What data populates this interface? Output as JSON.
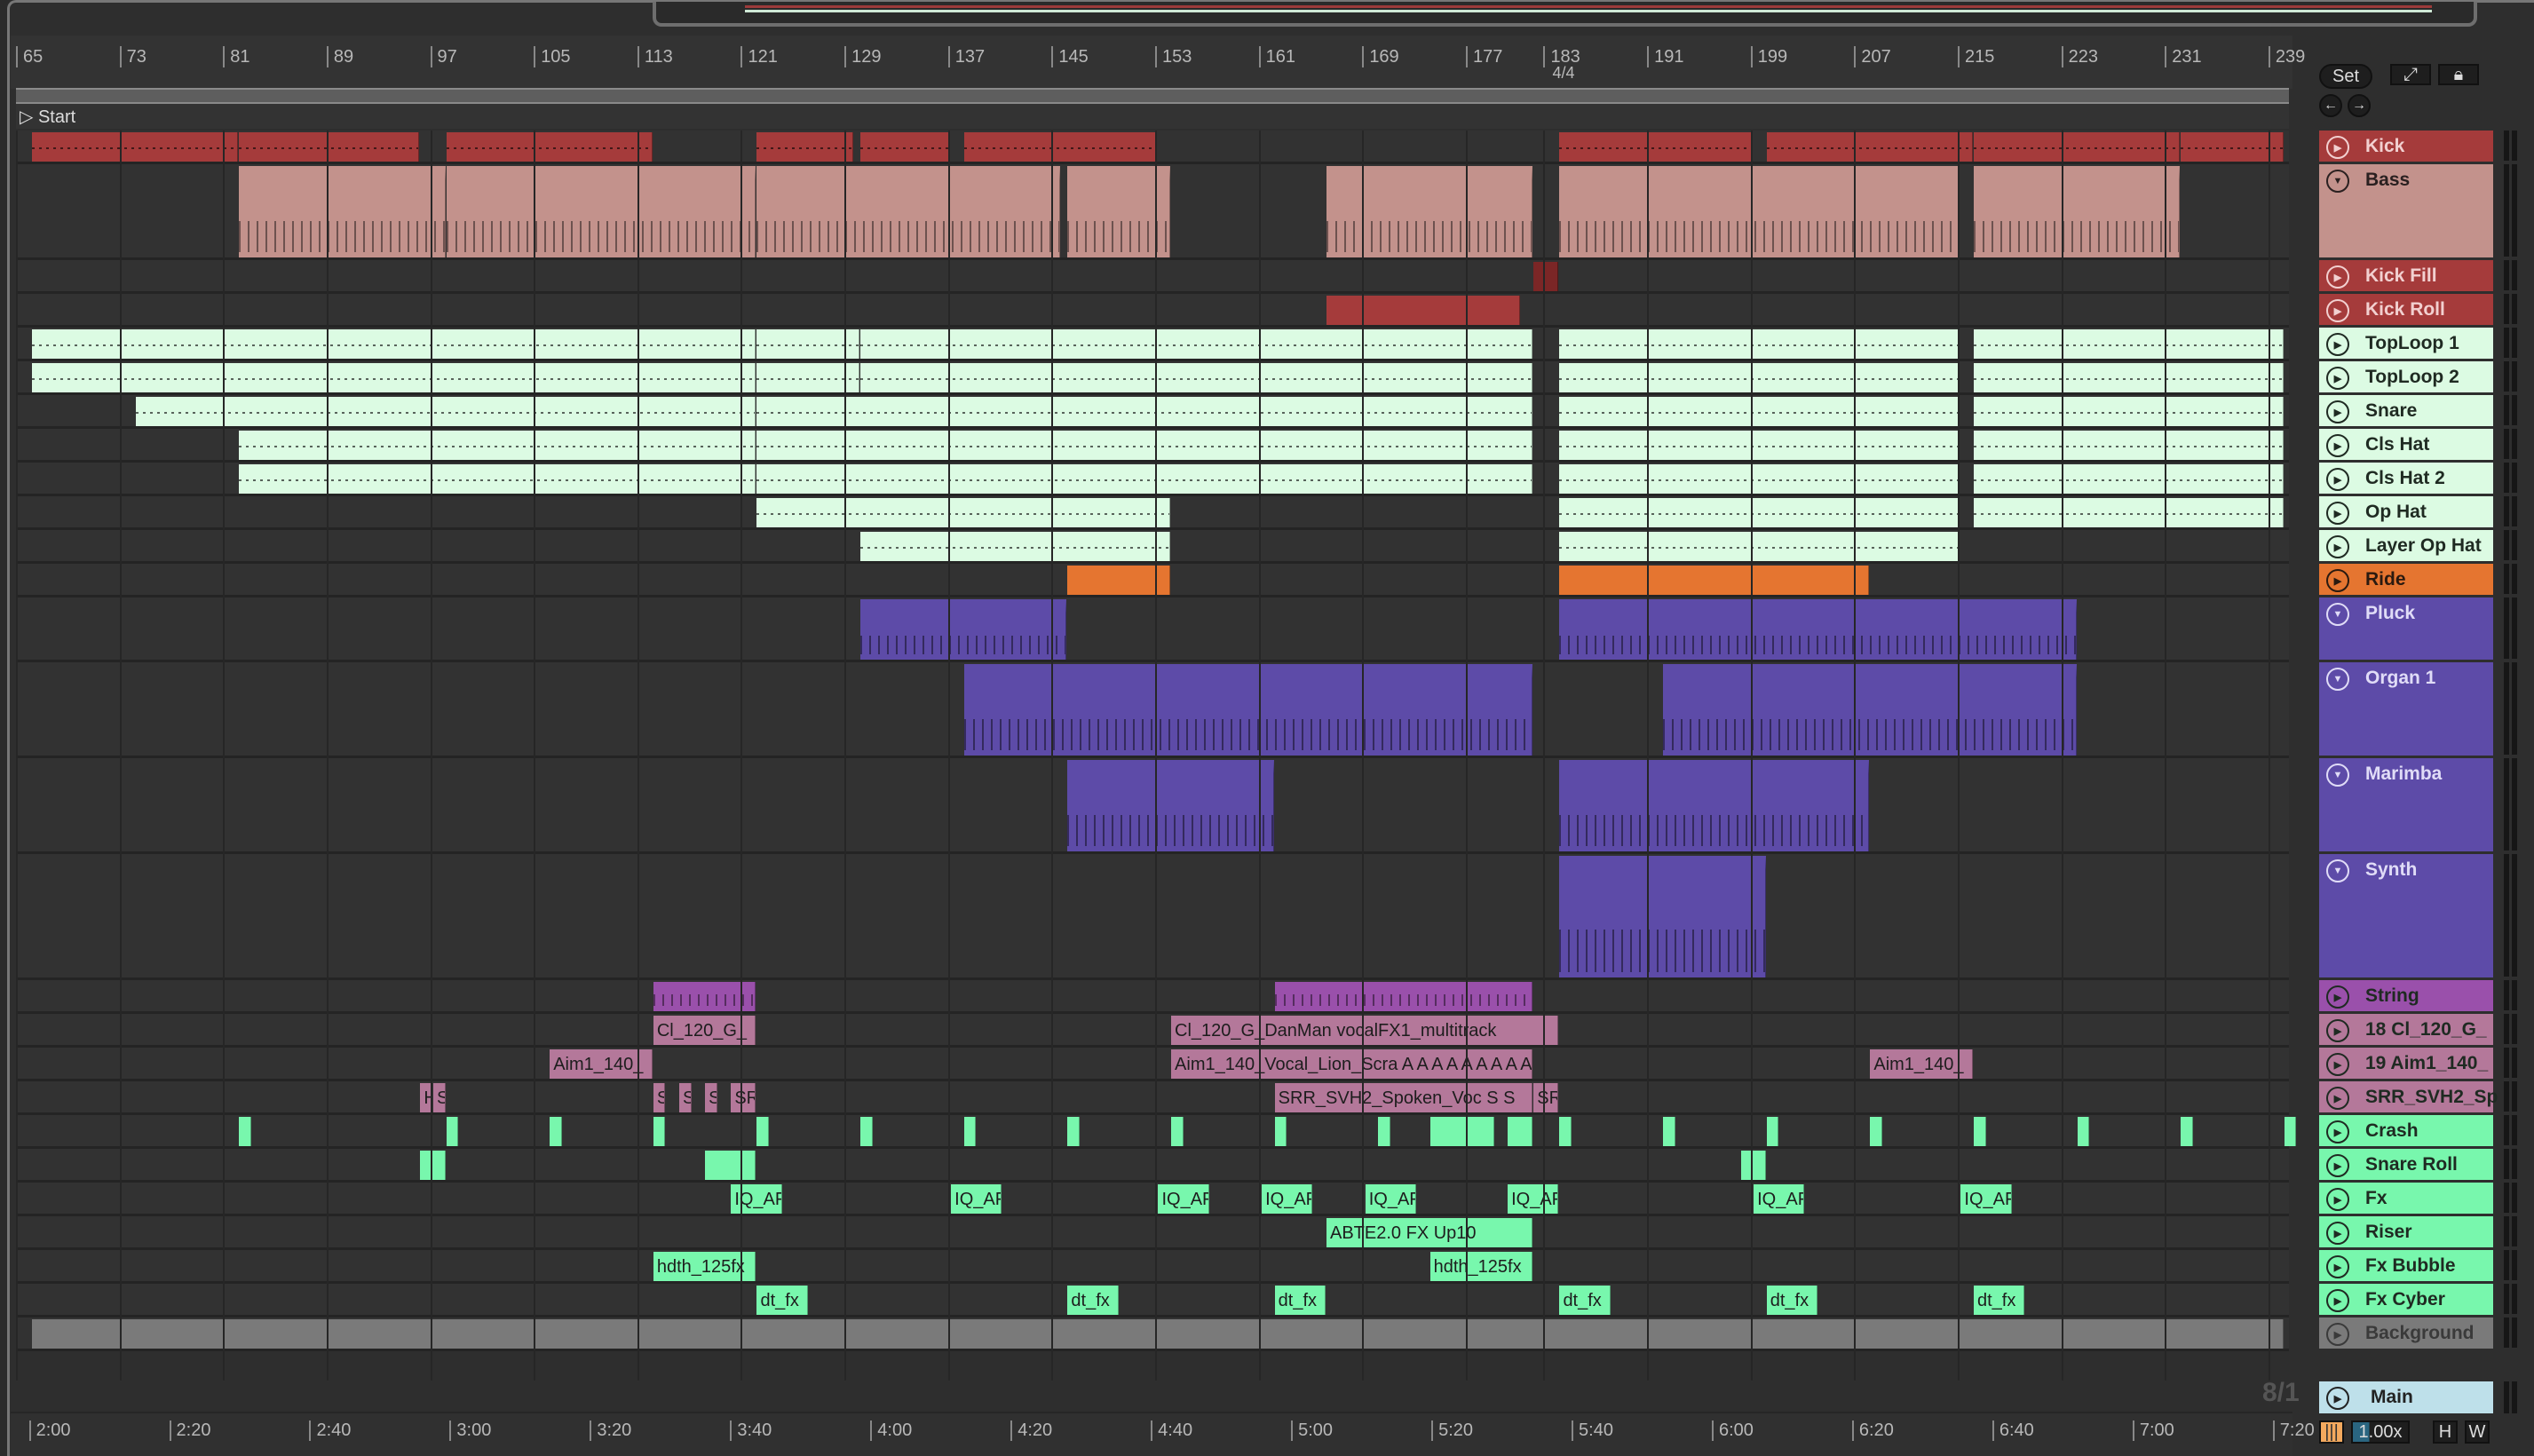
{
  "ruler": {
    "bars": [
      "65",
      "73",
      "81",
      "89",
      "97",
      "105",
      "113",
      "121",
      "129",
      "137",
      "145",
      "153",
      "161",
      "169",
      "177",
      "183",
      "191",
      "199",
      "207",
      "215",
      "223",
      "231",
      "239"
    ],
    "time_signature": "4/4",
    "locator": "Start"
  },
  "time_ruler": [
    "2:00",
    "2:20",
    "2:40",
    "3:00",
    "3:20",
    "3:40",
    "4:00",
    "4:20",
    "4:40",
    "5:00",
    "5:20",
    "5:40",
    "6:00",
    "6:20",
    "6:40",
    "7:00",
    "7:20"
  ],
  "controls": {
    "set": "Set",
    "prev": "←",
    "next": "→",
    "zoom": "1.00x",
    "h": "H",
    "w": "W",
    "grid": "8/1"
  },
  "colors": {
    "kick": "#a53b3b",
    "bass": "#c3928c",
    "fill": "#7b2626",
    "light": "#dcfbe3",
    "ride": "#e57530",
    "purple": "#5d4ba8",
    "string": "#9a50ab",
    "vocal": "#b4789a",
    "green": "#78f7ad",
    "bg": "#7a7a7a",
    "main": "#bee0ea"
  },
  "tracks": [
    {
      "name": "Kick",
      "h": "s",
      "color": "kick",
      "text": "#f2d0d0",
      "type": "line",
      "clips": [
        [
          65,
          81
        ],
        [
          81,
          95
        ],
        [
          97,
          113
        ],
        [
          121,
          128.5
        ],
        [
          129,
          136
        ],
        [
          137,
          152
        ],
        [
          183,
          198
        ],
        [
          199,
          215
        ],
        [
          215,
          231
        ],
        [
          231,
          239
        ]
      ]
    },
    {
      "name": "Bass",
      "h": "bass",
      "color": "bass",
      "text": "#2a2020",
      "fold": true,
      "type": "midi",
      "clips": [
        [
          81,
          97
        ],
        [
          97,
          121
        ],
        [
          121,
          144.5
        ],
        [
          145,
          153
        ],
        [
          165,
          181
        ],
        [
          183,
          214
        ],
        [
          215,
          231
        ]
      ]
    },
    {
      "name": "Kick Fill",
      "h": "s",
      "color": "kick",
      "clipcolor": "fill",
      "text": "#f2d0d0",
      "clips": [
        [
          181,
          183
        ]
      ]
    },
    {
      "name": "Kick Roll",
      "h": "s",
      "color": "kick",
      "text": "#f2d0d0",
      "clips": [
        [
          165,
          180
        ]
      ]
    },
    {
      "name": "TopLoop 1",
      "h": "s",
      "color": "light",
      "type": "line",
      "clips": [
        [
          65,
          121
        ],
        [
          121,
          129
        ],
        [
          129,
          181
        ],
        [
          183,
          214
        ],
        [
          215,
          239
        ]
      ]
    },
    {
      "name": "TopLoop 2",
      "h": "s",
      "color": "light",
      "type": "line",
      "clips": [
        [
          65,
          121
        ],
        [
          121,
          129
        ],
        [
          129,
          181
        ],
        [
          183,
          214
        ],
        [
          215,
          239
        ]
      ]
    },
    {
      "name": "Snare",
      "h": "s",
      "color": "light",
      "type": "line",
      "clips": [
        [
          73,
          121
        ],
        [
          121,
          181
        ],
        [
          183,
          214
        ],
        [
          215,
          239
        ]
      ]
    },
    {
      "name": "Cls Hat",
      "h": "s",
      "color": "light",
      "type": "line",
      "clips": [
        [
          81,
          121
        ],
        [
          121,
          181
        ],
        [
          183,
          214
        ],
        [
          215,
          239
        ]
      ]
    },
    {
      "name": "Cls Hat 2",
      "h": "s",
      "color": "light",
      "type": "line",
      "clips": [
        [
          81,
          121
        ],
        [
          121,
          181
        ],
        [
          183,
          214
        ],
        [
          215,
          239
        ]
      ]
    },
    {
      "name": "Op Hat",
      "h": "s",
      "color": "light",
      "type": "line",
      "clips": [
        [
          121,
          153
        ],
        [
          183,
          214
        ],
        [
          215,
          239
        ]
      ]
    },
    {
      "name": "Layer Op Hat",
      "h": "s",
      "color": "light",
      "type": "line",
      "clips": [
        [
          129,
          153
        ],
        [
          183,
          214
        ]
      ]
    },
    {
      "name": "Ride",
      "h": "s",
      "color": "ride",
      "text": "#2a1a10",
      "clips": [
        [
          145,
          153
        ],
        [
          183,
          207
        ]
      ]
    },
    {
      "name": "Pluck",
      "h": "pluck",
      "color": "purple",
      "text": "#e0dcf7",
      "fold": true,
      "type": "midi",
      "clips": [
        [
          129,
          145
        ],
        [
          183,
          223
        ]
      ]
    },
    {
      "name": "Organ 1",
      "h": "big",
      "color": "purple",
      "text": "#e0dcf7",
      "fold": true,
      "type": "midi",
      "clips": [
        [
          137,
          181
        ],
        [
          191,
          223
        ]
      ]
    },
    {
      "name": "Marimba",
      "h": "big",
      "color": "purple",
      "text": "#e0dcf7",
      "fold": true,
      "type": "midi",
      "clips": [
        [
          145,
          161
        ],
        [
          183,
          207
        ]
      ]
    },
    {
      "name": "Synth",
      "h": "synth",
      "color": "purple",
      "text": "#e0dcf7",
      "fold": true,
      "type": "midi",
      "clips": [
        [
          183,
          199
        ]
      ]
    },
    {
      "name": "String",
      "h": "s",
      "color": "string",
      "type": "midi",
      "clips": [
        [
          113,
          121
        ],
        [
          161,
          181
        ]
      ]
    },
    {
      "name": "18 Cl_120_G_",
      "h": "s",
      "color": "vocal",
      "clips": [
        [
          113,
          121,
          "Cl_120_G_"
        ],
        [
          153,
          183,
          "Cl_120_G_DanMan vocalFX1_multitrack"
        ]
      ]
    },
    {
      "name": "19 Aim1_140_",
      "h": "s",
      "color": "vocal",
      "clips": [
        [
          105,
          113,
          "Aim1_140_"
        ],
        [
          153,
          181,
          "Aim1_140_Vocal_Lion_Scra A A A A A A A A A"
        ],
        [
          207,
          215,
          "Aim1_140_"
        ]
      ]
    },
    {
      "name": "SRR_SVH2_Sp",
      "h": "s",
      "color": "vocal",
      "clips": [
        [
          95,
          96,
          "H"
        ],
        [
          96,
          97,
          "S"
        ],
        [
          113,
          114,
          "S"
        ],
        [
          115,
          116,
          "S"
        ],
        [
          117,
          118,
          "S"
        ],
        [
          119,
          121,
          "SR"
        ],
        [
          161,
          181,
          "SRR_SVH2_Spoken_Voc S S"
        ],
        [
          181,
          183,
          "SR"
        ]
      ]
    },
    {
      "name": "Crash",
      "h": "s",
      "color": "green",
      "clips": [
        [
          81,
          82
        ],
        [
          97,
          98
        ],
        [
          105,
          106
        ],
        [
          113,
          114
        ],
        [
          121,
          122
        ],
        [
          129,
          130
        ],
        [
          137,
          138
        ],
        [
          145,
          146
        ],
        [
          153,
          154
        ],
        [
          161,
          162
        ],
        [
          169,
          170
        ],
        [
          173,
          178
        ],
        [
          179,
          181
        ],
        [
          183,
          184
        ],
        [
          191,
          192
        ],
        [
          199,
          200
        ],
        [
          207,
          208
        ],
        [
          215,
          216
        ],
        [
          223,
          224
        ],
        [
          231,
          232
        ],
        [
          239,
          240
        ]
      ]
    },
    {
      "name": "Snare Roll",
      "h": "s",
      "color": "green",
      "clips": [
        [
          95,
          97
        ],
        [
          117,
          121
        ],
        [
          197,
          199
        ]
      ]
    },
    {
      "name": "Fx",
      "h": "s",
      "color": "green",
      "clips": [
        [
          119,
          123,
          "IQ_AF"
        ],
        [
          136,
          140,
          "IQ_AF"
        ],
        [
          152,
          156,
          "IQ_AF"
        ],
        [
          160,
          164,
          "IQ_AF"
        ],
        [
          168,
          172,
          "IQ_AF"
        ],
        [
          179,
          183,
          "IQ_AF"
        ],
        [
          198,
          202,
          "IQ_AF"
        ],
        [
          214,
          218,
          "IQ_AF"
        ]
      ]
    },
    {
      "name": "Riser",
      "h": "s",
      "color": "green",
      "clips": [
        [
          165,
          181,
          "ABTE2.0 FX Up10"
        ]
      ]
    },
    {
      "name": "Fx Bubble",
      "h": "s",
      "color": "green",
      "clips": [
        [
          113,
          121,
          "hdth_125fx"
        ],
        [
          173,
          181,
          "hdth_125fx"
        ]
      ]
    },
    {
      "name": "Fx Cyber",
      "h": "s",
      "color": "green",
      "clips": [
        [
          121,
          125,
          "dt_fx"
        ],
        [
          145,
          149,
          "dt_fx"
        ],
        [
          161,
          165,
          "dt_fx"
        ],
        [
          183,
          187,
          "dt_fx"
        ],
        [
          199,
          203,
          "dt_fx"
        ],
        [
          215,
          219,
          "dt_fx"
        ]
      ]
    },
    {
      "name": "Background",
      "h": "s",
      "color": "bg",
      "text": "#3a3a3a",
      "clips": [
        [
          65,
          239
        ]
      ]
    }
  ],
  "main": {
    "name": "Main"
  }
}
